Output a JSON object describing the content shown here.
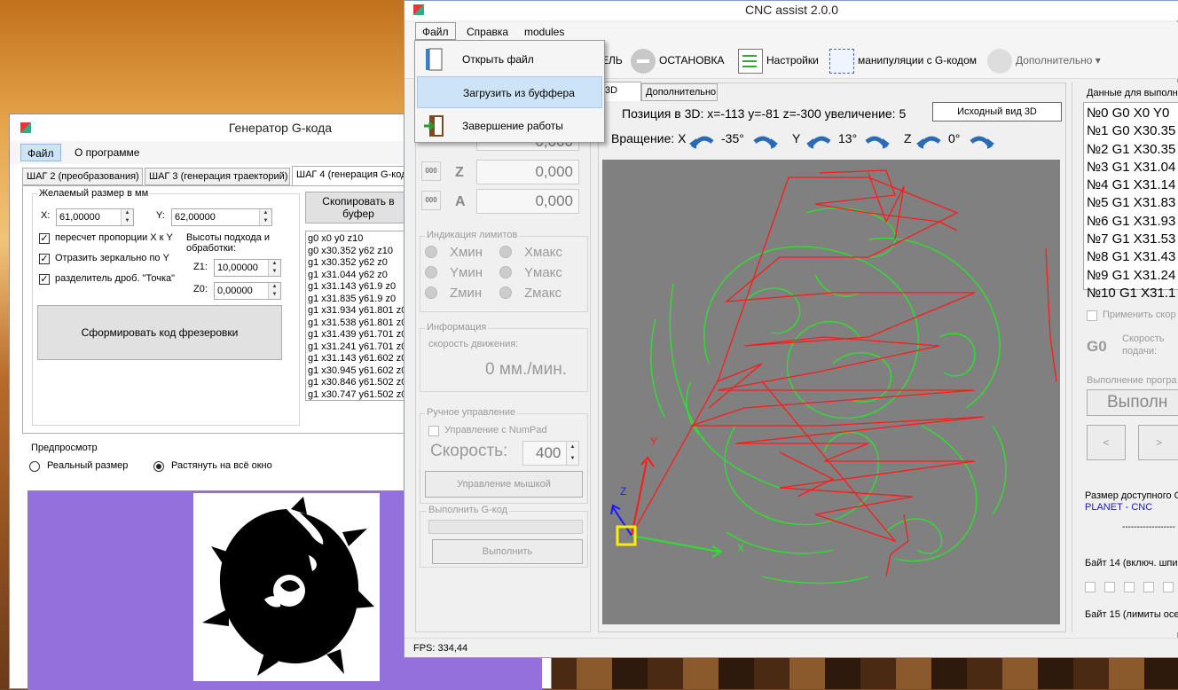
{
  "gen": {
    "title": "Генератор G-кода",
    "menu": [
      "Файл",
      "О программе"
    ],
    "tabs": [
      "ШАГ 2 (преобразования)",
      "ШАГ 3 (генерация траекторий)",
      "ШАГ 4 (генерация G-кода)"
    ],
    "size_group": "Желаемый размер в мм",
    "x_label": "X:",
    "x_value": "61,00000",
    "y_label": "Y:",
    "y_value": "62,00000",
    "cb1": "пересчет пропорции X к Y",
    "cb2": "Отразить зеркально по Y",
    "cb3": "разделитель дроб. \"Точка\"",
    "heights_label": "Высоты подхода и обработки:",
    "z1_label": "Z1:",
    "z1_value": "10,00000",
    "z0_label": "Z0:",
    "z0_value": "0,00000",
    "form_button": "Сформировать код фрезеровки",
    "copy_button": "Скопировать в буфер",
    "code_lines": [
      "g0 x0 y0 z10",
      "g0 x30.352 y62 z10",
      "g1 x30.352 y62 z0",
      "g1 x31.044 y62 z0",
      "g1 x31.143 y61.9 z0",
      "g1 x31.835 y61.9 z0",
      "g1 x31.934 y61.801 z0",
      "g1 x31.538 y61.801 z0",
      "g1 x31.439 y61.701 z0",
      "g1 x31.241 y61.701 z0",
      "g1 x31.143 y61.602 z0",
      "g1 x30.945 y61.602 z0",
      "g1 x30.846 y61.502 z0",
      "g1 x30.747 y61.502 z0"
    ],
    "preview_label": "Предпросмотр",
    "radio1": "Реальный размер",
    "radio2": "Растянуть на всё окно"
  },
  "cnc": {
    "title": "CNC assist 2.0.0",
    "menu": [
      "Файл",
      "Справка",
      "modules"
    ],
    "toolbar": {
      "partial": "ЕЛЬ",
      "stop": "ОСТАНОВКА",
      "settings": "Настройки",
      "gcode": "манипуляции с G-кодом",
      "more": "Дополнительно"
    },
    "tabs": [
      "3D",
      "Дополнительно"
    ],
    "position": "Позиция в 3D: x=-113 y=-81 z=-300 увеличение: 5",
    "reset_view": "Исходный вид 3D",
    "rotation": "Вращение: X",
    "rx": "-35°",
    "y_label": "Y",
    "ry": "13°",
    "z_label": "Z",
    "rz": "0°",
    "coords": [
      {
        "axis": "Z",
        "value": "0,000"
      },
      {
        "axis": "A",
        "value": "0,000"
      }
    ],
    "coord_top_partial": "0,000",
    "zero_label": "000",
    "limits_label": "Индикация лимитов",
    "limits": [
      "Xмин",
      "Xмакс",
      "Yмин",
      "Yмакс",
      "Zмин",
      "Zмакс"
    ],
    "info_label": "Информация",
    "speed_caption": "скорость движения:",
    "speed_value": "0 мм./мин.",
    "manual_label": "Ручное управление",
    "numpad": "Управление с NumPad",
    "speed_label": "Скорость:",
    "speed_input": "400",
    "mouse_button": "Управление мышкой",
    "exec_label": "Выполнить G-код",
    "exec_button": "Выполнить",
    "right_header": "Данные для выполне",
    "gcode_lines": [
      "№0 G0 X0 Y0",
      "№1 G0 X30.35",
      "№2 G1 X30.35",
      "№3 G1 X31.04",
      "№4 G1 X31.14",
      "№5 G1 X31.83",
      "№6 G1 X31.93",
      "№7 G1 X31.53",
      "№8 G1 X31.43",
      "№9 G1 X31.24",
      "№10 G1 X31.1"
    ],
    "apply": "Применить скор",
    "g0": "G0",
    "feed_speed": "Скорость подачи:",
    "exec_prog_label": "Выполнение програ",
    "exec_prog_button": "Выполн",
    "prev": "<",
    "next": ">",
    "size_label": "Размер доступного С",
    "planet": "PLANET - CNC",
    "dashes": "------------------",
    "byte14": "Байт 14 (включ. шпи",
    "byte15": "Байт 15 (лимиты осе",
    "fps": "FPS: 334,44",
    "axis_x": "X",
    "axis_y": "Y",
    "axis_z": "Z"
  },
  "dropdown": {
    "items": [
      "Открыть файл",
      "Загрузить из буффера",
      "Завершение работы"
    ]
  }
}
